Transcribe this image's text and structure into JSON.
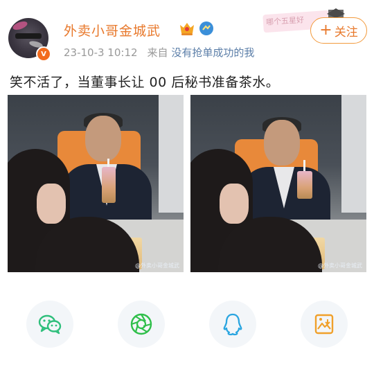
{
  "author": {
    "name": "外卖小哥金城武",
    "verified_badge": "V",
    "medal_icon": "crown-medal-icon",
    "rank_icon": "rank-badge-icon"
  },
  "meta": {
    "time": "23-10-3 10:12",
    "source_prefix": "来自",
    "client": "没有抢单成功的我"
  },
  "decoration": {
    "text": "哪个五星好"
  },
  "follow": {
    "plus": "+",
    "label": "关注"
  },
  "post": {
    "text": "笑不活了，当董事长让 00 后秘书准备茶水。"
  },
  "images": [
    {
      "watermark": "@外卖小哥金城武"
    },
    {
      "watermark": "@外卖小哥金城武"
    }
  ],
  "share": [
    {
      "icon": "wechat-icon",
      "color": "#2fbf7c"
    },
    {
      "icon": "moments-icon",
      "color": "#2fbf4a"
    },
    {
      "icon": "qq-icon",
      "color": "#2aa5e0"
    },
    {
      "icon": "save-image-icon",
      "color": "#f0a02a"
    }
  ]
}
